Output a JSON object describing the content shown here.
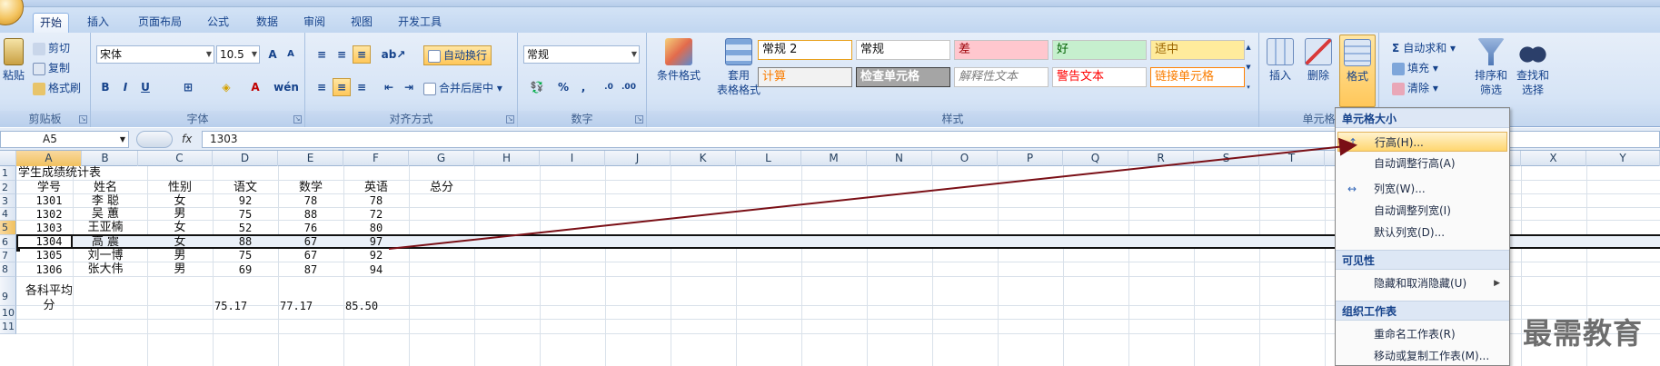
{
  "tabs": [
    "开始",
    "插入",
    "页面布局",
    "公式",
    "数据",
    "审阅",
    "视图",
    "开发工具"
  ],
  "ribbon": {
    "clipboard": {
      "label": "剪贴板",
      "paste": "粘贴",
      "cut": "剪切",
      "copy": "复制",
      "format_painter": "格式刷"
    },
    "font": {
      "label": "字体",
      "name": "宋体",
      "size": "10.5",
      "bold": "B",
      "italic": "I",
      "underline": "U"
    },
    "alignment": {
      "label": "对齐方式",
      "wrap": "自动换行",
      "merge": "合并后居中"
    },
    "number": {
      "label": "数字",
      "format": "常规",
      "percent": "%",
      "comma": ","
    },
    "styles": {
      "label": "样式",
      "conditional": "条件格式",
      "table_line1": "套用",
      "table_line2": "表格格式",
      "cells": [
        {
          "text": "常规 2",
          "bg": "#ffffff",
          "color": "#111111",
          "border": "#e8a01c"
        },
        {
          "text": "常规",
          "bg": "#ffffff",
          "color": "#111111",
          "border": "#c4c4c4"
        },
        {
          "text": "差",
          "bg": "#ffc7ce",
          "color": "#9c0006",
          "border": "#c4c4c4"
        },
        {
          "text": "好",
          "bg": "#c6efce",
          "color": "#006100",
          "border": "#c4c4c4"
        },
        {
          "text": "适中",
          "bg": "#ffeb9c",
          "color": "#9c6500",
          "border": "#c4c4c4"
        },
        {
          "text": "计算",
          "bg": "#f2f2f2",
          "color": "#fa7d00",
          "border": "#7f7f7f"
        },
        {
          "text": "检查单元格",
          "bg": "#a5a5a5",
          "color": "#ffffff",
          "border": "#3f3f3f"
        },
        {
          "text": "解释性文本",
          "bg": "#ffffff",
          "color": "#7f7f7f",
          "border": "#c4c4c4"
        },
        {
          "text": "警告文本",
          "bg": "#ffffff",
          "color": "#ff0000",
          "border": "#c4c4c4"
        },
        {
          "text": "链接单元格",
          "bg": "#ffffff",
          "color": "#fa7d00",
          "border": "#ff8001"
        }
      ]
    },
    "cells_group": {
      "label": "单元格",
      "insert": "插入",
      "delete": "删除",
      "format": "格式"
    },
    "editing": {
      "autosum": "自动求和",
      "fill": "填充",
      "clear": "清除",
      "sort_line1": "排序和",
      "sort_line2": "筛选",
      "find_line1": "查找和",
      "find_line2": "选择"
    }
  },
  "formula_bar": {
    "name_box": "A5",
    "fx": "fx",
    "formula": "1303"
  },
  "columns": [
    "A",
    "B",
    "C",
    "D",
    "E",
    "F",
    "G",
    "H",
    "I",
    "J",
    "K",
    "L",
    "M",
    "N",
    "O",
    "P",
    "Q",
    "R",
    "S",
    "T",
    "U",
    "V",
    "W",
    "X",
    "Y"
  ],
  "rows": [
    "1",
    "2",
    "3",
    "4",
    "5",
    "6",
    "7",
    "8",
    "9",
    "10",
    "11"
  ],
  "sheet": {
    "title": "学生成绩统计表",
    "headers": [
      "学号",
      "姓名",
      "性别",
      "语文",
      "数学",
      "英语",
      "总分"
    ],
    "records": [
      [
        "1301",
        "李  聪",
        "女",
        "92",
        "78",
        "78"
      ],
      [
        "1302",
        "吴  蕙",
        "男",
        "75",
        "88",
        "72"
      ],
      [
        "1303",
        "王亚楠",
        "女",
        "52",
        "76",
        "80"
      ],
      [
        "1304",
        "高  震",
        "女",
        "88",
        "67",
        "97"
      ],
      [
        "1305",
        "刘一博",
        "男",
        "75",
        "67",
        "92"
      ],
      [
        "1306",
        "张大伟",
        "男",
        "69",
        "87",
        "94"
      ]
    ],
    "avg_label_1": "各科平均",
    "avg_label_2": "分",
    "averages": [
      "75.17",
      "77.17",
      "85.50"
    ]
  },
  "menu": {
    "section_size": "单元格大小",
    "row_height": "行高(H)...",
    "autofit_row": "自动调整行高(A)",
    "col_width": "列宽(W)...",
    "autofit_col": "自动调整列宽(I)",
    "default_width": "默认列宽(D)...",
    "section_visibility": "可见性",
    "hide_unhide": "隐藏和取消隐藏(U)",
    "section_organize": "组织工作表",
    "rename": "重命名工作表(R)",
    "move_copy": "移动或复制工作表(M)..."
  },
  "watermark": "最需教育",
  "colors": {
    "arrow": "#7a0f16",
    "accent": "#15428b",
    "highlight": "#ffd66f"
  }
}
